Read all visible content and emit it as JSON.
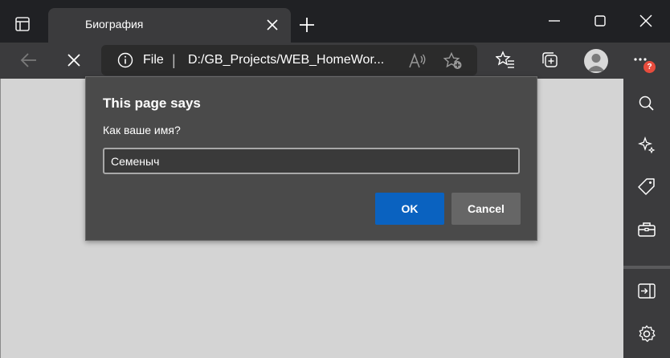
{
  "tab": {
    "title": "Биография"
  },
  "address": {
    "scheme": "File",
    "separator": "|",
    "url": "D:/GB_Projects/WEB_HomeWor..."
  },
  "notifications": {
    "badge": "?"
  },
  "dialog": {
    "title": "This page says",
    "message": "Как ваше имя?",
    "input_value": "Семеныч",
    "ok_label": "OK",
    "cancel_label": "Cancel"
  },
  "icons": {
    "tab_actions": "tab-actions-icon",
    "tab_close": "close-icon",
    "new_tab": "plus-icon",
    "minimize": "minimize-icon",
    "maximize": "maximize-icon",
    "close_window": "close-icon",
    "back": "back-arrow-icon",
    "stop": "stop-icon",
    "info": "info-icon",
    "read_aloud": "read-aloud-icon",
    "add_favorite": "add-favorite-icon",
    "favorites": "favorites-icon",
    "collections": "collections-icon",
    "profile": "profile-avatar",
    "more": "more-icon",
    "search": "search-icon",
    "discover": "sparkle-icon",
    "shopping": "tag-icon",
    "tools": "toolbox-icon",
    "pane": "open-pane-icon",
    "settings": "gear-icon"
  },
  "colors": {
    "titlebar": "#202124",
    "toolbar": "#3b3b3d",
    "dialog_bg": "#4a4a4a",
    "ok_button": "#0a62c0",
    "cancel_button": "#666666",
    "badge": "#e84c3d"
  }
}
